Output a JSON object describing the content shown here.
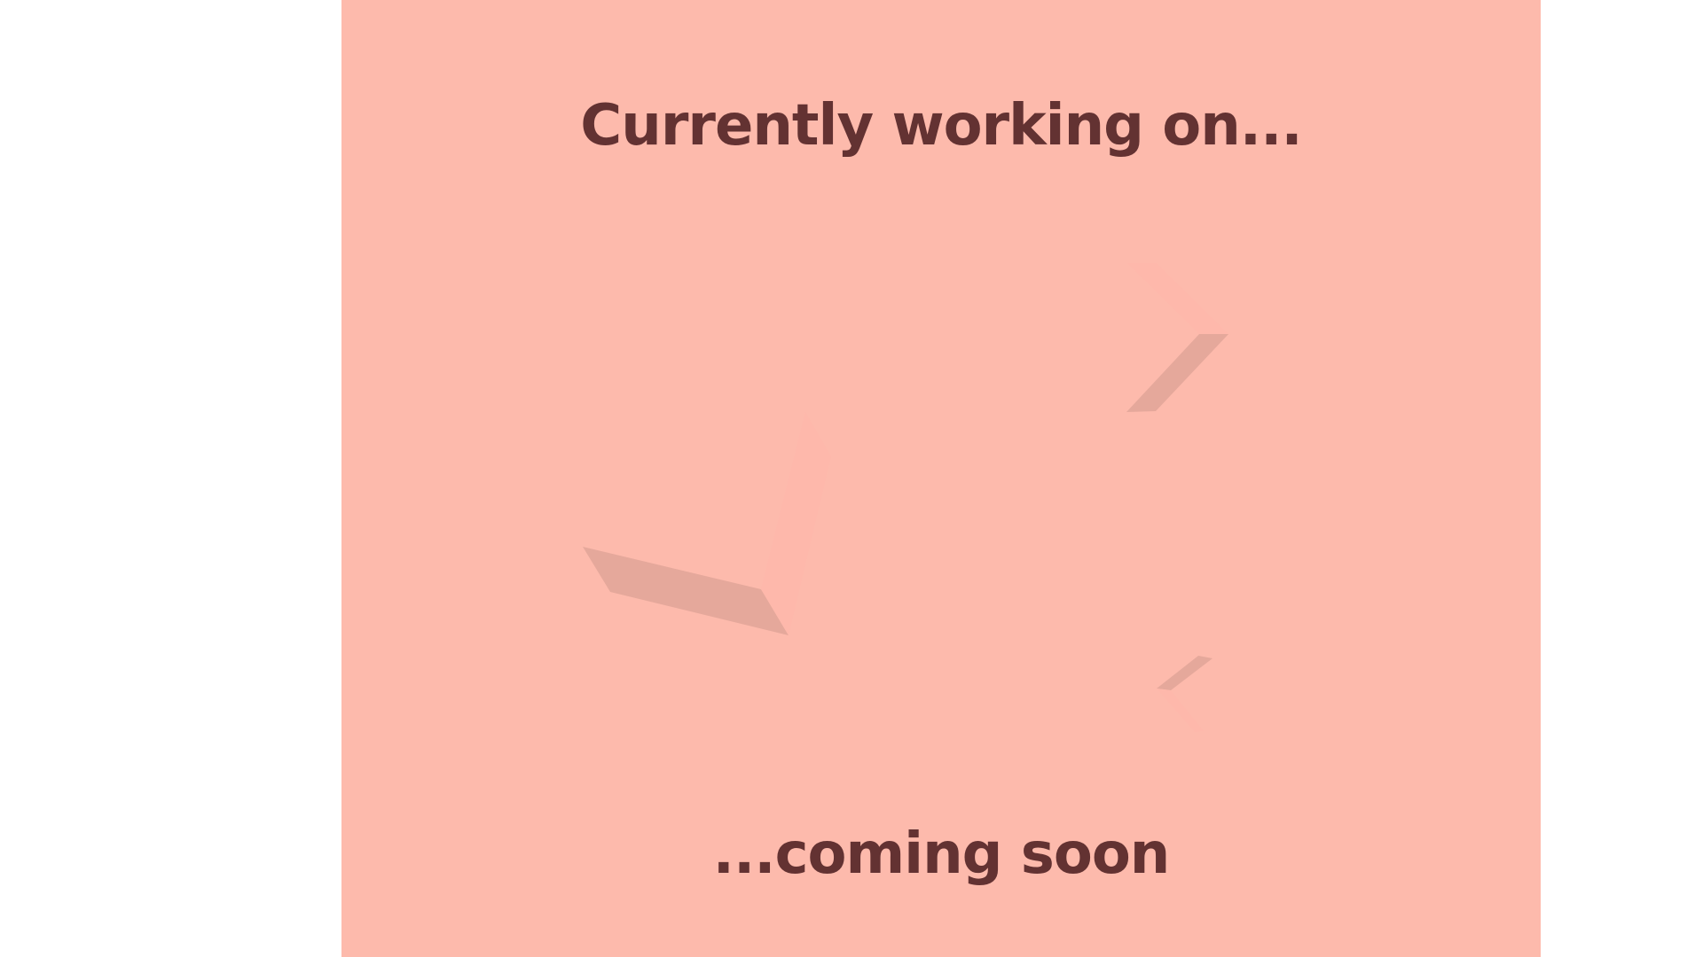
{
  "page": {
    "background_color": "#ffffff",
    "panel_color": "#fdbaac",
    "text_color": "#633232",
    "shape_light_color": "#feb8ab",
    "shape_shadow_color": "#e5a89b"
  },
  "content": {
    "heading_top": "Currently working on...",
    "heading_bottom": "...coming soon"
  },
  "decorations": [
    {
      "name": "chevron-right-shape"
    },
    {
      "name": "check-shape"
    },
    {
      "name": "chevron-left-small-shape"
    }
  ]
}
